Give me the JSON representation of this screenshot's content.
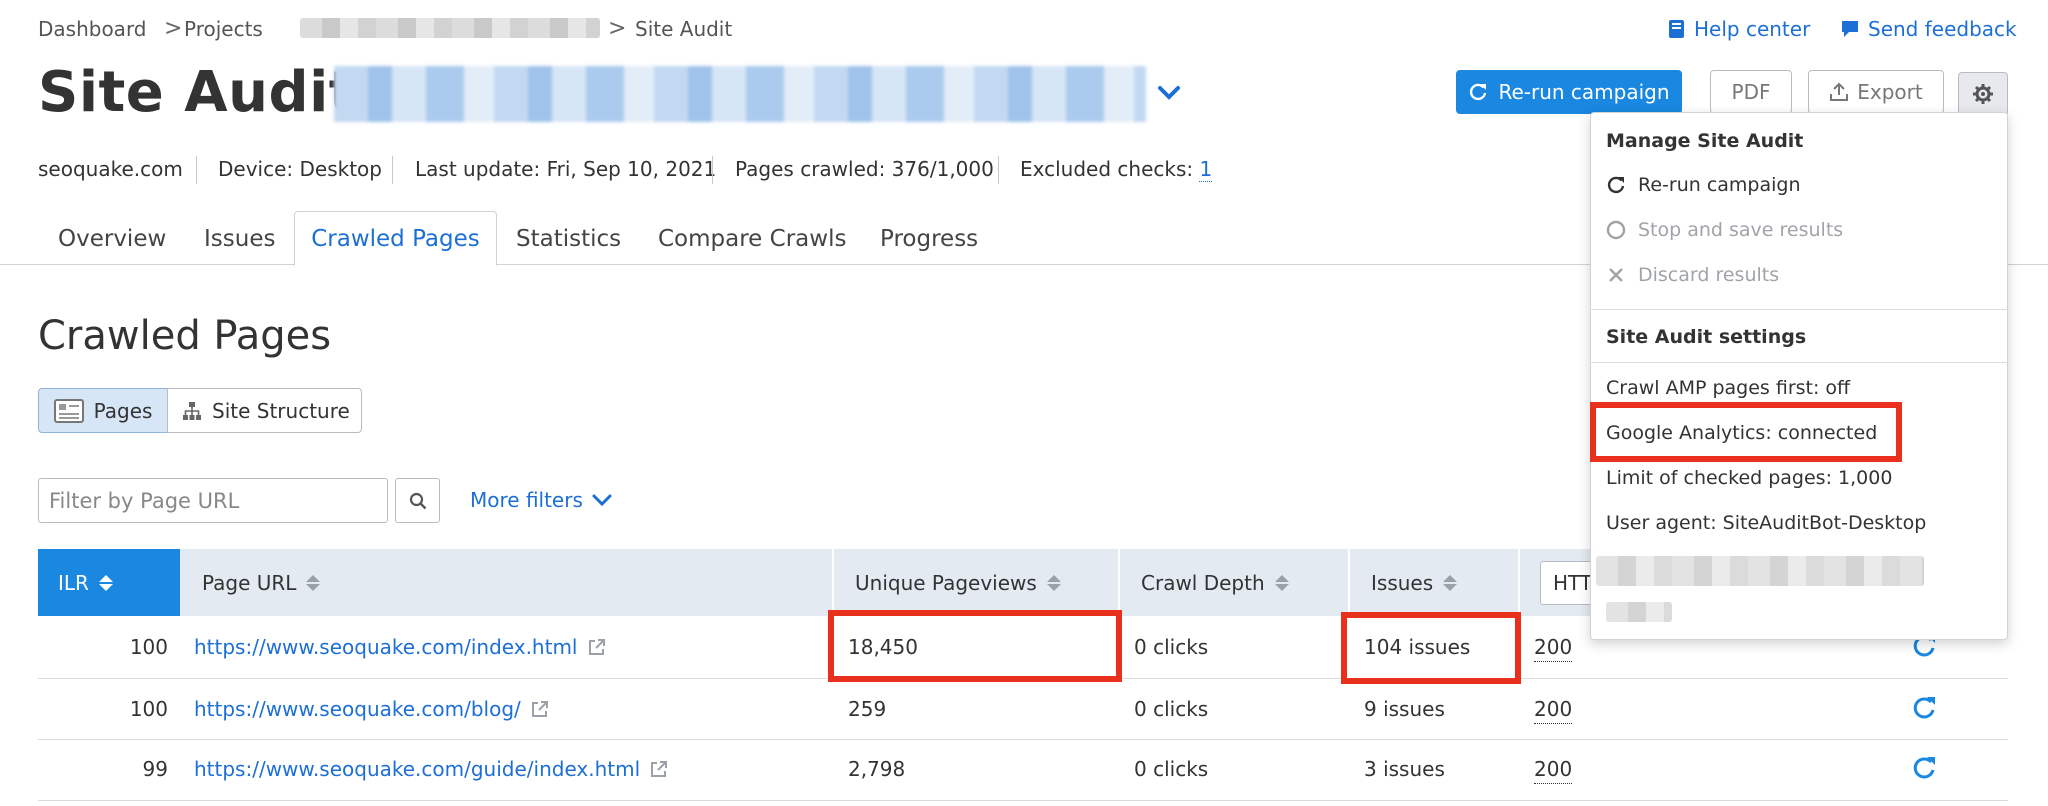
{
  "breadcrumb": {
    "items": [
      "Dashboard",
      "Projects",
      "Site Audit"
    ],
    "separator": ">"
  },
  "header": {
    "help_center": "Help center",
    "send_feedback": "Send feedback",
    "title_prefix": "Site Audit:",
    "rerun_label": "Re-run campaign",
    "pdf_label": "PDF",
    "export_label": "Export"
  },
  "meta": {
    "domain": "seoquake.com",
    "device": "Device: Desktop",
    "last_update": "Last update: Fri, Sep 10, 2021",
    "pages_crawled": "Pages crawled: 376/1,000",
    "excluded_label": "Excluded checks:",
    "excluded_count": "1"
  },
  "tabs": [
    "Overview",
    "Issues",
    "Crawled Pages",
    "Statistics",
    "Compare Crawls",
    "Progress"
  ],
  "active_tab": "Crawled Pages",
  "section_title": "Crawled Pages",
  "view_toggle": {
    "pages_label": "Pages",
    "structure_label": "Site Structure"
  },
  "filter": {
    "placeholder": "Filter by Page URL",
    "more_filters": "More filters"
  },
  "table": {
    "columns": [
      "ILR",
      "Page URL",
      "Unique Pageviews",
      "Crawl Depth",
      "Issues"
    ],
    "http_select": "HTT",
    "rows": [
      {
        "ilr": "100",
        "url": "https://www.seoquake.com/index.html",
        "pageviews": "18,450",
        "depth": "0 clicks",
        "issues": "104 issues",
        "status": "200"
      },
      {
        "ilr": "100",
        "url": "https://www.seoquake.com/blog/",
        "pageviews": "259",
        "depth": "0 clicks",
        "issues": "9 issues",
        "status": "200"
      },
      {
        "ilr": "99",
        "url": "https://www.seoquake.com/guide/index.html",
        "pageviews": "2,798",
        "depth": "0 clicks",
        "issues": "3 issues",
        "status": "200"
      }
    ]
  },
  "dropdown": {
    "manage_heading": "Manage Site Audit",
    "rerun": "Re-run campaign",
    "stop": "Stop and save results",
    "discard": "Discard results",
    "settings_heading": "Site Audit settings",
    "amp": "Crawl AMP pages first: off",
    "analytics": "Google Analytics: connected",
    "limit": "Limit of checked pages: 1,000",
    "user_agent": "User agent: SiteAuditBot-Desktop"
  },
  "colors": {
    "accent": "#1a87e0",
    "link": "#1d6fd6",
    "highlight": "#e8301c",
    "header_bg": "#e3eaf1"
  }
}
